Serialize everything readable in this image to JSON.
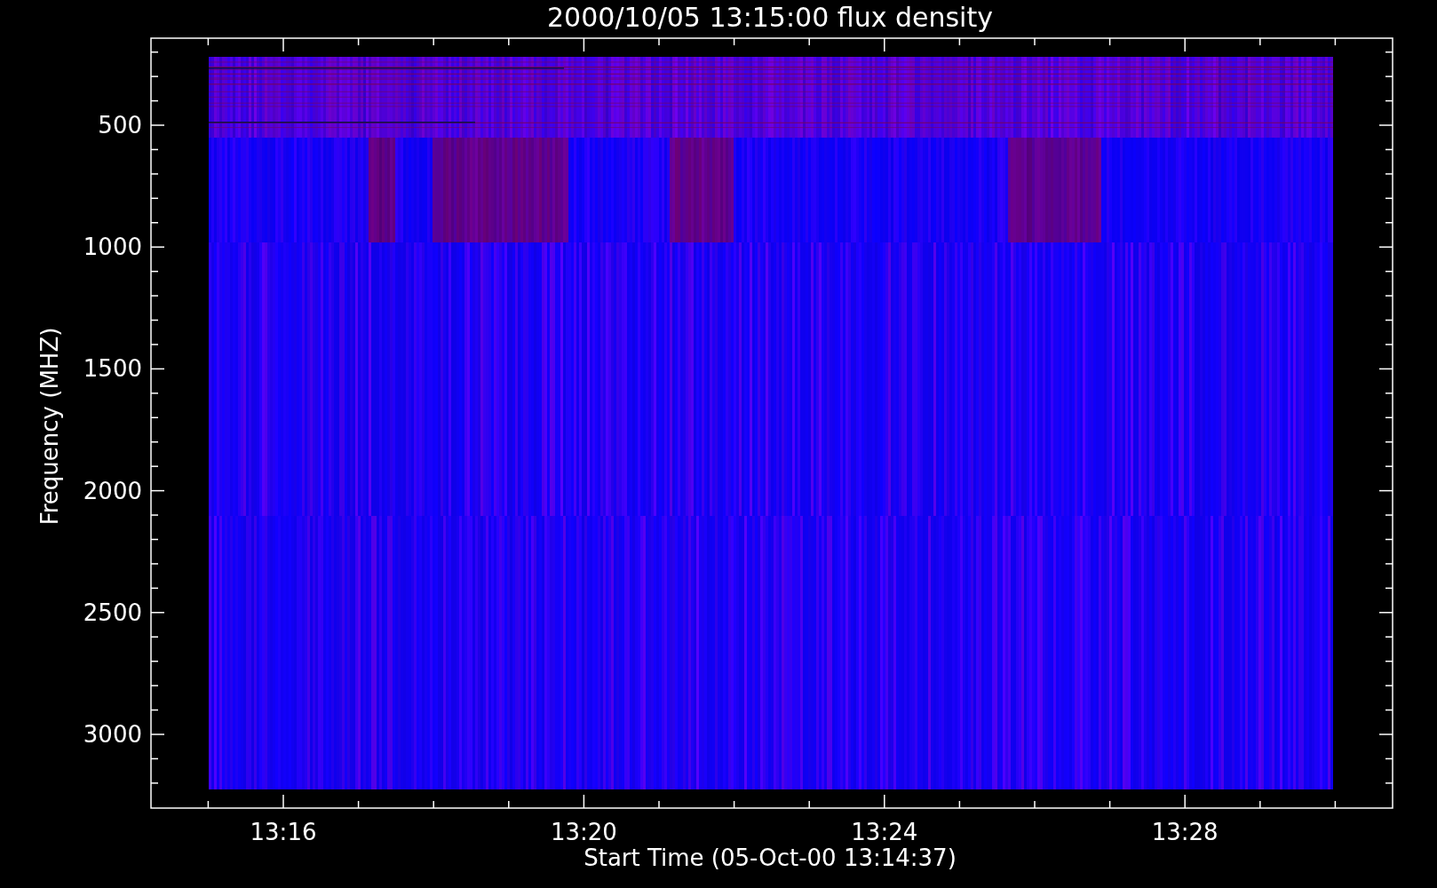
{
  "title": "2000/10/05 13:15:00 flux density",
  "y_axis": {
    "label": "Frequency (MHZ)",
    "ticks": [
      "500",
      "1000",
      "1500",
      "2000",
      "2500",
      "3000"
    ]
  },
  "x_axis": {
    "label": "Start Time (05-Oct-00 13:14:37)",
    "ticks": [
      "13:16",
      "13:20",
      "13:24",
      "13:28"
    ]
  }
}
